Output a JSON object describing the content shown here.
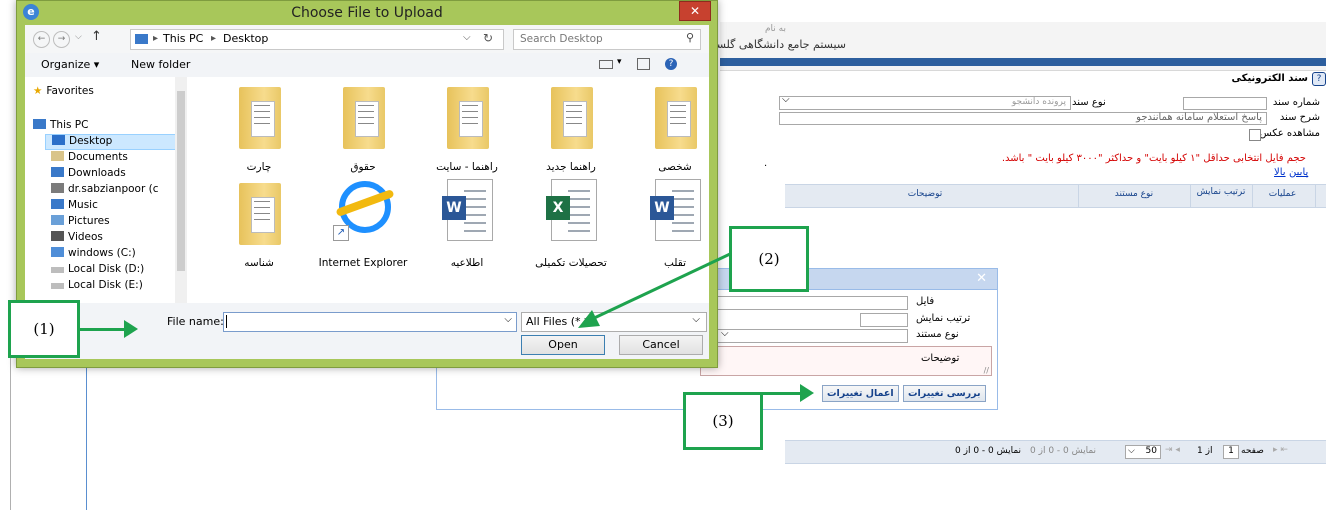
{
  "file_dialog": {
    "title": "Choose File to Upload",
    "close": "✕",
    "breadcrumb": [
      "This PC",
      "Desktop"
    ],
    "search_placeholder": "Search Desktop",
    "toolbar": {
      "organize": "Organize ▾",
      "new_folder": "New folder"
    },
    "nav": {
      "favorites": "Favorites",
      "this_pc": "This PC",
      "items": [
        "Desktop",
        "Documents",
        "Downloads",
        "dr.sabzianpoor (c",
        "Music",
        "Pictures",
        "Videos",
        "windows (C:)",
        "Local Disk (D:)",
        "Local Disk (E:)"
      ]
    },
    "files": [
      {
        "label": "چارت",
        "type": "folder"
      },
      {
        "label": "حقوق",
        "type": "folder"
      },
      {
        "label": "راهنما - سایت",
        "type": "folder"
      },
      {
        "label": "راهنما جدید",
        "type": "folder"
      },
      {
        "label": "شخصی",
        "type": "folder"
      },
      {
        "label": "شناسه",
        "type": "folder"
      },
      {
        "label": "Internet Explorer",
        "type": "ie"
      },
      {
        "label": "اطلاعیه",
        "type": "word"
      },
      {
        "label": "تحصیلات تکمیلی",
        "type": "excel"
      },
      {
        "label": "تقلب",
        "type": "word"
      }
    ],
    "file_name_label": "File name:",
    "file_name_value": "",
    "file_type": "All Files (*.*)",
    "open_label": "Open",
    "cancel_label": "Cancel"
  },
  "web": {
    "header_title": "سیستم جامع دانشگاهی گلستان",
    "header_faded": "به نام",
    "section_title": "سند الکترونیکی",
    "doc_number_label": "شماره سند",
    "doc_type_label": "نوع سند",
    "doc_type_value": "پرونده دانشجو",
    "doc_desc_label": "شرح سند",
    "doc_desc_value": "پاسخ استعلام سامانه همانندجو",
    "view_photo_label": "مشاهده عکس",
    "size_note": "حجم فایل انتخابی حداقل \"۱ کیلو بایت\" و حداکثر \"۳۰۰۰ کیلو بایت \" باشد.",
    "link_up": "بالا",
    "link_down": "پایین",
    "grid_headers": {
      "ops": "عملیات",
      "order": "ترتیب نمایش",
      "doc_type": "نوع مستند",
      "desc": "توضیحات"
    },
    "pager": {
      "page_label": "صفحه",
      "page_value": "1",
      "of": "از 1",
      "page_size": "50",
      "display": "نمایش 0 - 0 از 0"
    }
  },
  "attach": {
    "close": "✕",
    "file_label": "فایل",
    "order_label": "ترتیب نمایش",
    "doc_type_label": "نوع مستند",
    "desc_label": "توضیحات",
    "review_button": "بررسی تغییرات",
    "apply_button": "اعمال تغییرات"
  },
  "callouts": {
    "c1": "(1)",
    "c2": "(2)",
    "c3": "(3)"
  }
}
